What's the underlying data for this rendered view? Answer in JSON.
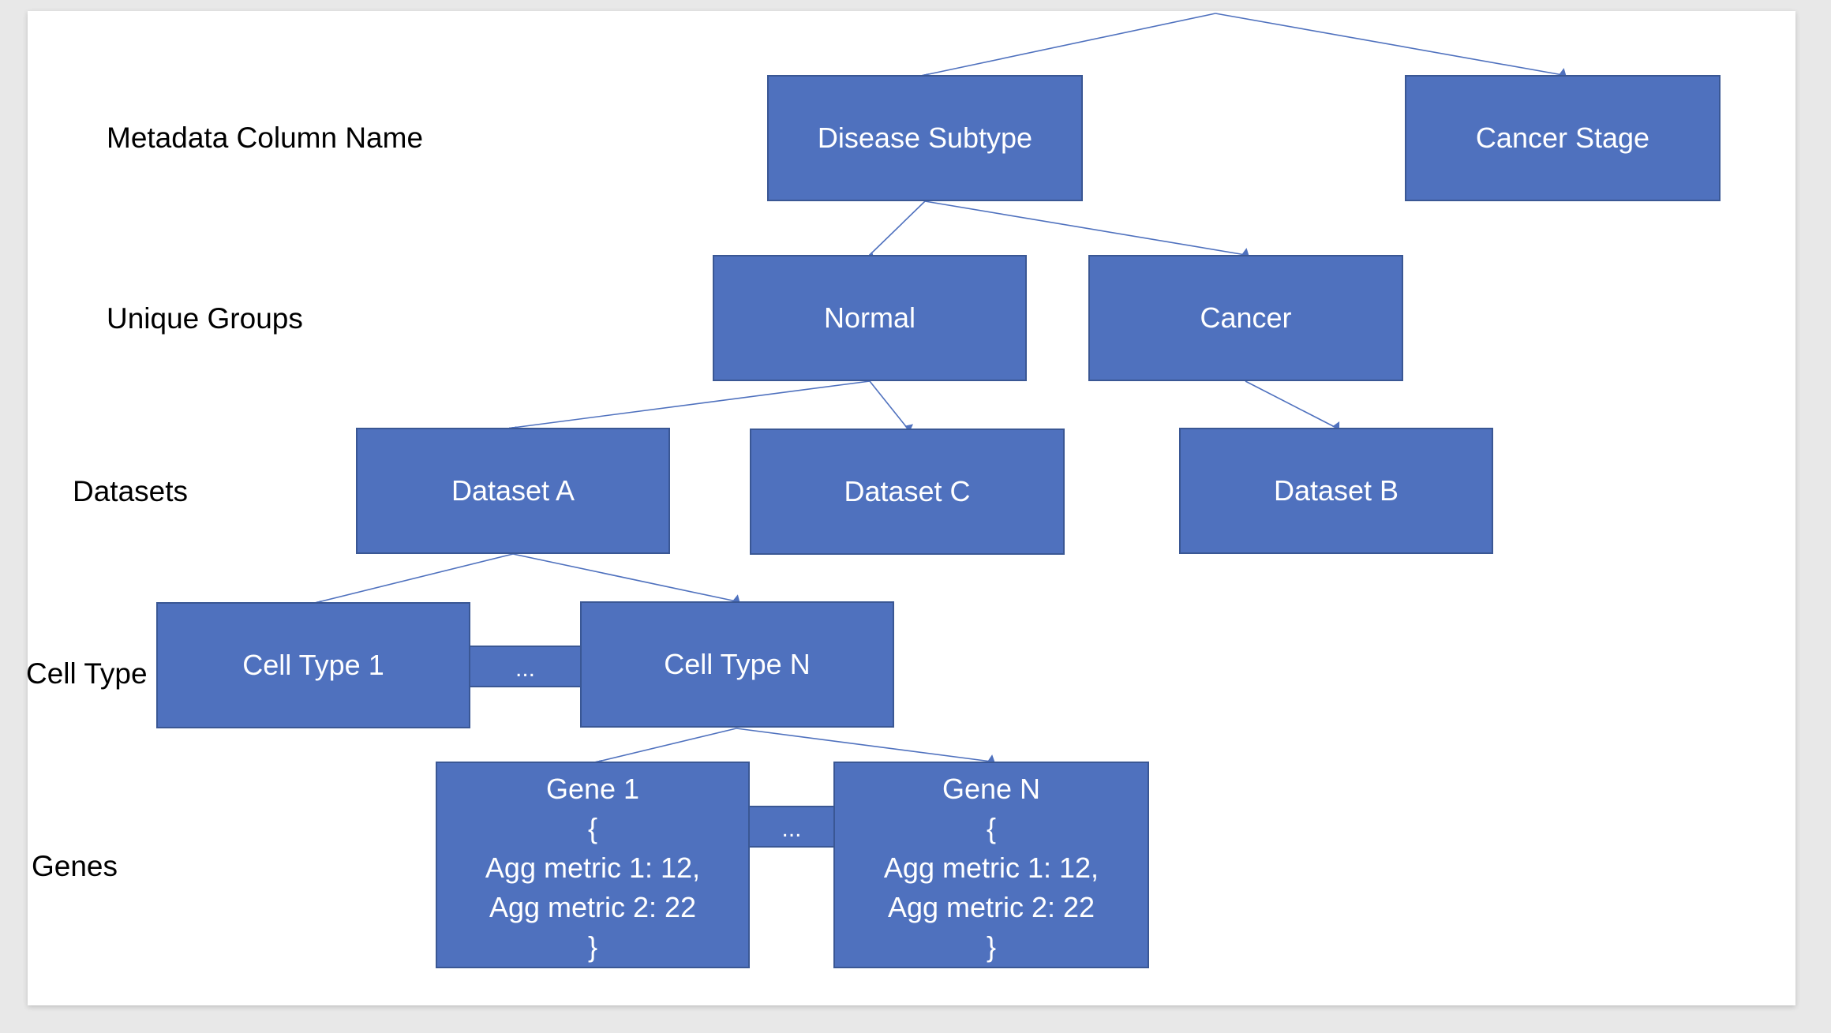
{
  "row_labels": {
    "metadata": "Metadata Column Name",
    "groups": "Unique Groups",
    "datasets": "Datasets",
    "cell_type": "Cell Type",
    "genes": "Genes"
  },
  "nodes": {
    "disease_subtype": "Disease Subtype",
    "cancer_stage": "Cancer Stage",
    "normal": "Normal",
    "cancer": "Cancer",
    "dataset_a": "Dataset A",
    "dataset_c": "Dataset C",
    "dataset_b": "Dataset B",
    "cell_type_1": "Cell Type 1",
    "cell_type_n": "Cell Type N",
    "cell_ellipsis": "...",
    "gene_ellipsis": "...",
    "gene_1": {
      "name": "Gene 1",
      "open": "{",
      "metric1": "Agg metric 1: 12,",
      "metric2": "Agg metric 2: 22",
      "close": "}"
    },
    "gene_n": {
      "name": "Gene N",
      "open": "{",
      "metric1": "Agg metric 1: 12,",
      "metric2": "Agg metric 2: 22",
      "close": "}"
    }
  },
  "colors": {
    "node_fill": "#4f71be",
    "node_border": "#3a5794",
    "edge": "#4f71be"
  }
}
